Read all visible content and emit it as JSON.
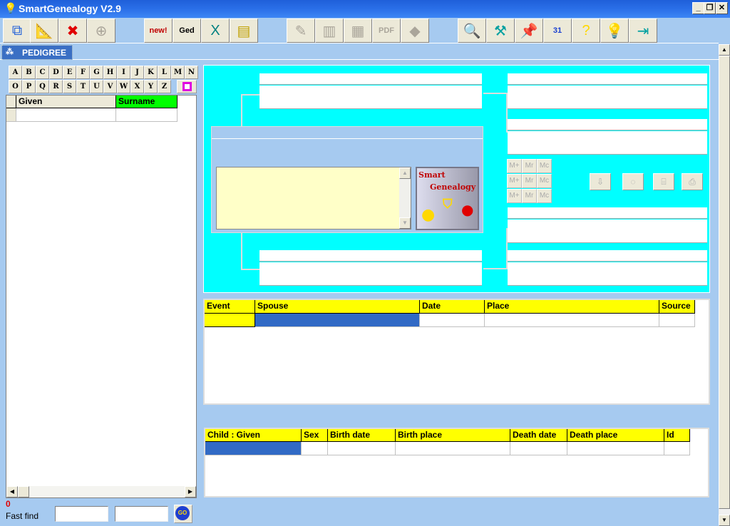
{
  "window": {
    "title": "SmartGenealogy  V2.9",
    "minimize": "_",
    "restore": "❐",
    "close": "✕"
  },
  "toolbar": [
    {
      "name": "pedigree-view-button",
      "icon": "⧉",
      "enabled": true,
      "color": "#1f5fd9"
    },
    {
      "name": "edit-button",
      "icon": "📐",
      "enabled": true,
      "color": "#333"
    },
    {
      "name": "delete-button",
      "icon": "✖",
      "enabled": true,
      "color": "#e00000"
    },
    {
      "name": "target-button",
      "icon": "⊕",
      "enabled": false,
      "color": "#aaa59a"
    },
    {
      "name": "new-button",
      "icon": "new!",
      "enabled": true,
      "color": "#c00000"
    },
    {
      "name": "gedcom-button",
      "icon": "Ged",
      "enabled": true,
      "color": "#000"
    },
    {
      "name": "excel-export-button",
      "icon": "X",
      "enabled": true,
      "color": "#008080"
    },
    {
      "name": "archive-button",
      "icon": "▤",
      "enabled": true,
      "color": "#c0a000"
    },
    {
      "name": "tree-report-button",
      "icon": "✎",
      "enabled": false,
      "color": "#aaa59a"
    },
    {
      "name": "print-report-button",
      "icon": "▥",
      "enabled": false,
      "color": "#aaa59a"
    },
    {
      "name": "document-button",
      "icon": "▦",
      "enabled": false,
      "color": "#aaa59a"
    },
    {
      "name": "pdf-button",
      "icon": "PDF",
      "enabled": false,
      "color": "#aaa59a"
    },
    {
      "name": "map-button",
      "icon": "◆",
      "enabled": false,
      "color": "#aaa59a"
    },
    {
      "name": "search-button",
      "icon": "🔍",
      "enabled": false,
      "color": "#aaa59a"
    },
    {
      "name": "tools-button",
      "icon": "⚒",
      "enabled": true,
      "color": "#00a0a0"
    },
    {
      "name": "notes-button",
      "icon": "📌",
      "enabled": true,
      "color": "#008080"
    },
    {
      "name": "calendar-button",
      "icon": "31",
      "enabled": true,
      "color": "#1a3fd0"
    },
    {
      "name": "help-button",
      "icon": "?",
      "enabled": true,
      "color": "#ffd800"
    },
    {
      "name": "about-button",
      "icon": "💡",
      "enabled": true,
      "color": "#e00000"
    },
    {
      "name": "exit-button",
      "icon": "⇥",
      "enabled": true,
      "color": "#00a0a0"
    }
  ],
  "tabs": [
    {
      "label": "PEDIGREE"
    }
  ],
  "alphabet": [
    "A",
    "B",
    "C",
    "D",
    "E",
    "F",
    "G",
    "H",
    "I",
    "J",
    "K",
    "L",
    "M",
    "N",
    "O",
    "P",
    "Q",
    "R",
    "S",
    "T",
    "U",
    "V",
    "W",
    "X",
    "Y",
    "Z"
  ],
  "person_list": {
    "columns": [
      "Given",
      "Surname"
    ],
    "sorted_column_color": "#00ff00"
  },
  "count": "0",
  "fast_find": {
    "label": "Fast find",
    "go": "GO",
    "value1": "",
    "value2": ""
  },
  "logo": {
    "line1": "Smart",
    "line2": "Genealogy"
  },
  "memory_buttons": [
    "M+",
    "Mr",
    "Mc",
    "M+",
    "Mr",
    "Mc",
    "M+",
    "Mr",
    "Mc"
  ],
  "pedigree_tools": [
    {
      "name": "down-arrow-button",
      "icon": "⇩"
    },
    {
      "name": "clock-button",
      "icon": "◌"
    },
    {
      "name": "tree-button",
      "icon": "⌸"
    },
    {
      "name": "print-button",
      "icon": "⎙"
    }
  ],
  "events": {
    "columns": [
      "Event",
      "Spouse",
      "Date",
      "Place",
      "Source"
    ]
  },
  "children": {
    "columns": [
      "Child : Given",
      "Sex",
      "Birth date",
      "Birth place",
      "Death date",
      "Death place",
      "Id"
    ]
  },
  "colors": {
    "header": "#ffff00",
    "selection": "#316ac5",
    "pedigree_bg": "#00ffff",
    "background": "#a6caf0"
  }
}
